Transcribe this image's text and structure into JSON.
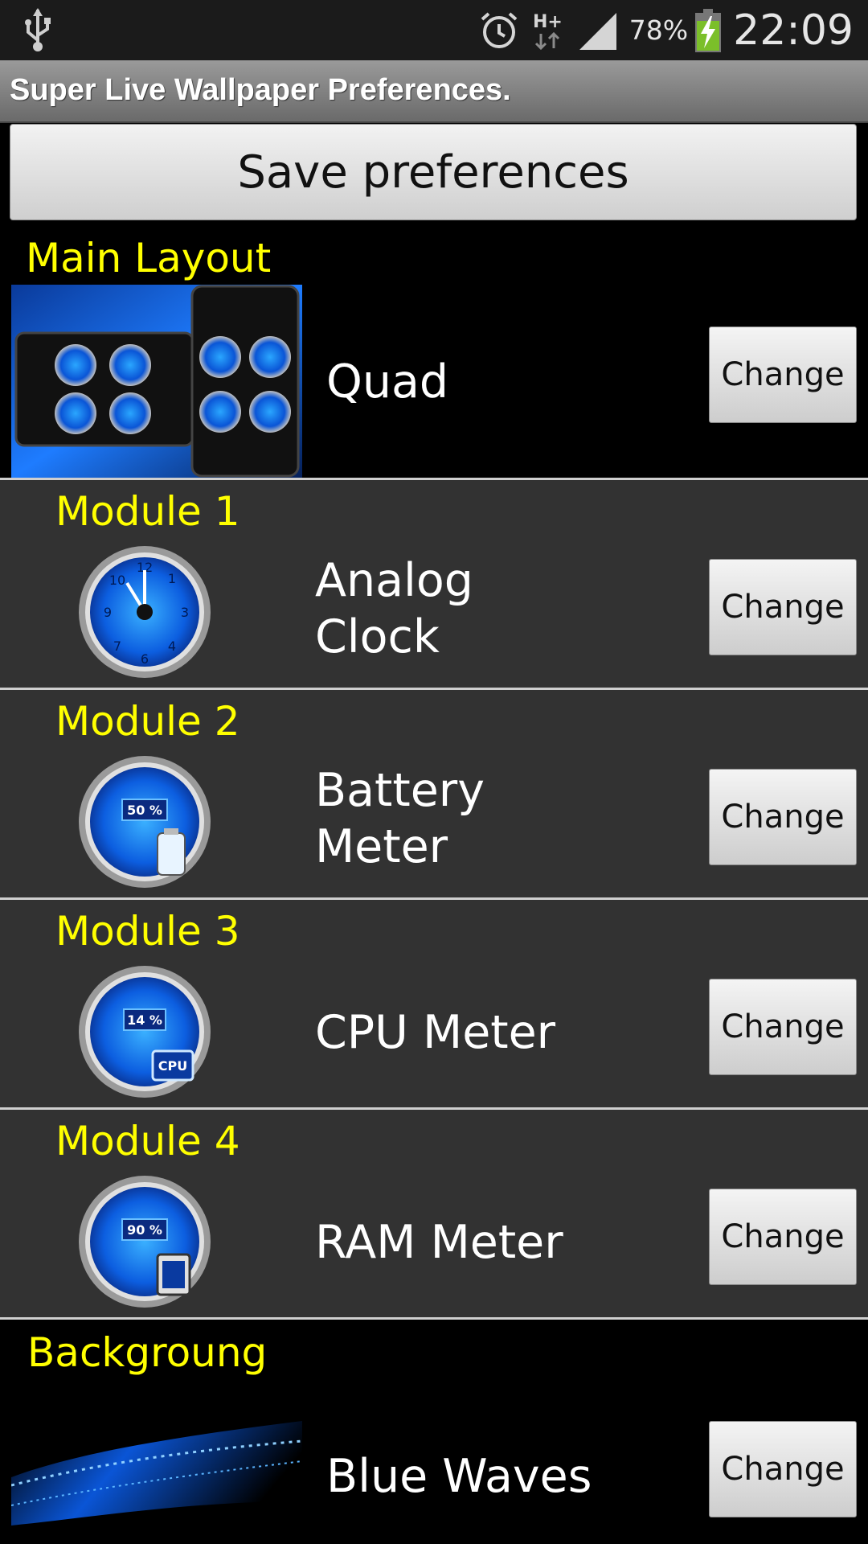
{
  "status_bar": {
    "icons": [
      "usb-icon",
      "alarm-icon",
      "hplus-data-icon",
      "signal-icon",
      "battery-charging-icon"
    ],
    "battery_percent": "78%",
    "time": "22:09"
  },
  "title_bar": {
    "title": "Super Live Wallpaper Preferences."
  },
  "save_button": {
    "label": "Save preferences"
  },
  "sections": [
    {
      "title": "Main Layout",
      "value": "Quad",
      "button": "Change",
      "icon": "quad-layout-thumbnail"
    },
    {
      "title": "Module 1",
      "value": "Analog Clock",
      "button": "Change",
      "icon": "analog-clock-gauge-icon"
    },
    {
      "title": "Module 2",
      "value": "Battery Meter",
      "button": "Change",
      "icon": "battery-meter-gauge-icon",
      "gauge_text": "50 %"
    },
    {
      "title": "Module 3",
      "value": "CPU Meter",
      "button": "Change",
      "icon": "cpu-meter-gauge-icon",
      "gauge_text": "14 %"
    },
    {
      "title": "Module 4",
      "value": "RAM Meter",
      "button": "Change",
      "icon": "ram-meter-gauge-icon",
      "gauge_text": "90 %"
    },
    {
      "title": "Backgroung",
      "value": "Blue Waves",
      "button": "Change",
      "icon": "blue-waves-thumbnail"
    }
  ],
  "colors": {
    "section_title": "#ffff00",
    "accent_blue": "#1e7cff"
  }
}
